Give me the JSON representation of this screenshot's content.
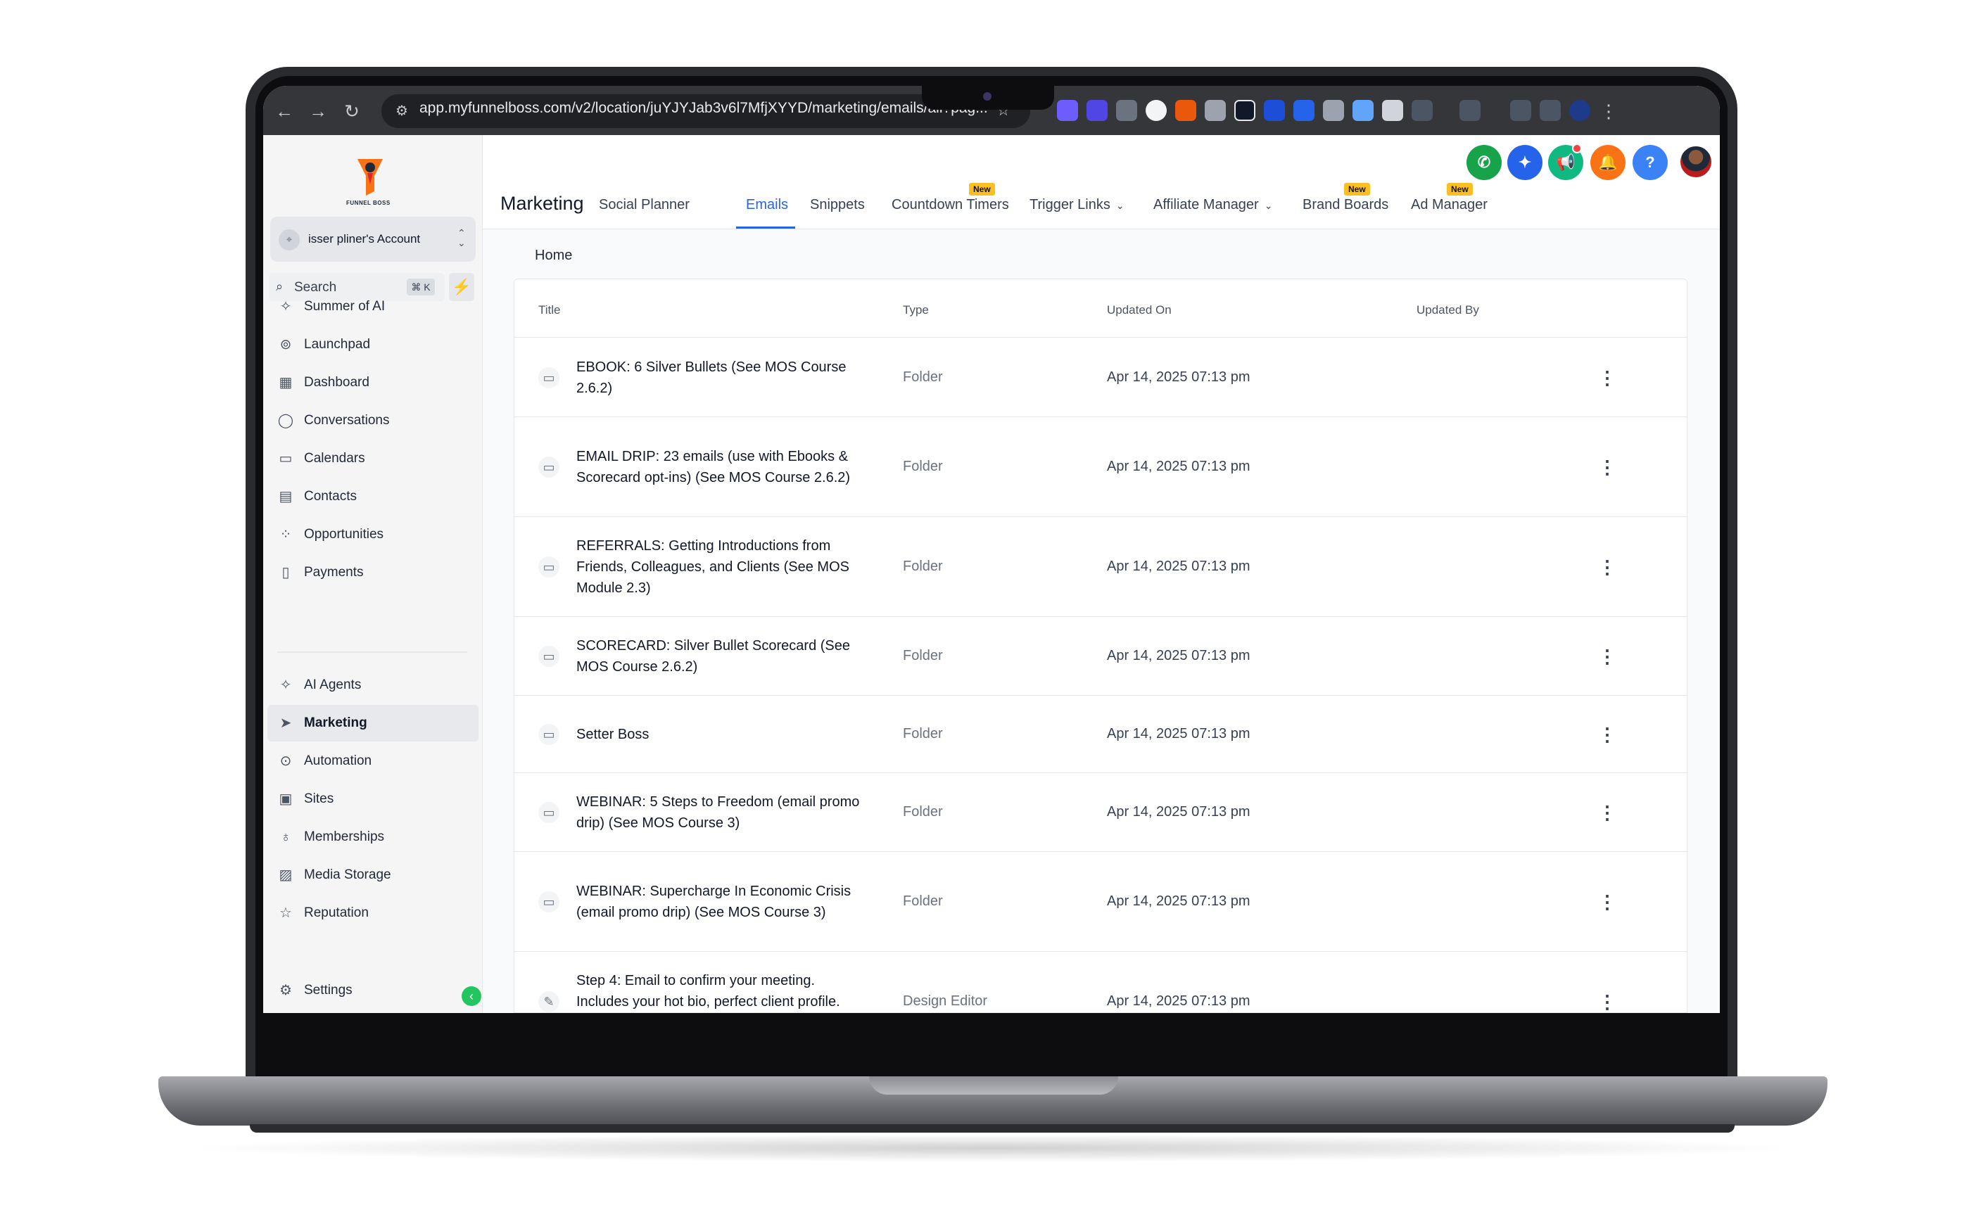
{
  "browser": {
    "url": "app.myfunnelboss.com/v2/location/juYJYJab3v6l7MfjXYYD/marketing/emails/all?pag..."
  },
  "app": {
    "logo_text": "FUNNEL BOSS"
  },
  "sidebar": {
    "account_name": "isser pliner's Account",
    "search_label": "Search",
    "search_shortcut": "⌘ K",
    "items": [
      {
        "label": "Summer of AI",
        "icon": "sparkle-icon",
        "glyph": "✧"
      },
      {
        "label": "Launchpad",
        "icon": "rocket-icon",
        "glyph": "⊚"
      },
      {
        "label": "Dashboard",
        "icon": "grid-icon",
        "glyph": "▦"
      },
      {
        "label": "Conversations",
        "icon": "chat-bubble-icon",
        "glyph": "◯"
      },
      {
        "label": "Calendars",
        "icon": "calendar-icon",
        "glyph": "▭"
      },
      {
        "label": "Contacts",
        "icon": "contacts-icon",
        "glyph": "▤"
      },
      {
        "label": "Opportunities",
        "icon": "pipeline-icon",
        "glyph": "⁘"
      },
      {
        "label": "Payments",
        "icon": "receipt-icon",
        "glyph": "▯"
      }
    ],
    "items2": [
      {
        "label": "AI Agents",
        "icon": "sparkle-icon",
        "glyph": "✧"
      },
      {
        "label": "Marketing",
        "icon": "send-icon",
        "glyph": "➤",
        "active": true
      },
      {
        "label": "Automation",
        "icon": "automation-icon",
        "glyph": "⊙"
      },
      {
        "label": "Sites",
        "icon": "globe-icon",
        "glyph": "▣"
      },
      {
        "label": "Memberships",
        "icon": "award-icon",
        "glyph": "♁"
      },
      {
        "label": "Media Storage",
        "icon": "image-icon",
        "glyph": "▨"
      },
      {
        "label": "Reputation",
        "icon": "star-icon",
        "glyph": "☆"
      }
    ],
    "settings_label": "Settings"
  },
  "header": {
    "title": "Marketing",
    "tabs": [
      {
        "label": "Social Planner"
      },
      {
        "label": "Emails",
        "active": true
      },
      {
        "label": "Snippets"
      },
      {
        "label": "Countdown Timers",
        "badge": "New"
      },
      {
        "label": "Trigger Links",
        "dropdown": true
      },
      {
        "label": "Affiliate Manager",
        "dropdown": true
      },
      {
        "label": "Brand Boards",
        "badge": "New"
      },
      {
        "label": "Ad Manager",
        "badge": "New"
      }
    ],
    "help_glyph": "?"
  },
  "content": {
    "breadcrumb": "Home",
    "columns": [
      "Title",
      "Type",
      "Updated On",
      "Updated By"
    ],
    "rows": [
      {
        "title": "EBOOK: 6 Silver Bullets (See MOS Course 2.6.2)",
        "type": "Folder",
        "updated_on": "Apr 14, 2025 07:13 pm",
        "icon": "folder-icon"
      },
      {
        "title": "EMAIL DRIP: 23 emails (use with Ebooks & Scorecard opt-ins) (See MOS Course 2.6.2)",
        "type": "Folder",
        "updated_on": "Apr 14, 2025 07:13 pm",
        "icon": "folder-icon"
      },
      {
        "title": "REFERRALS: Getting Introductions from Friends, Colleagues, and Clients (See MOS Module 2.3)",
        "type": "Folder",
        "updated_on": "Apr 14, 2025 07:13 pm",
        "icon": "folder-icon"
      },
      {
        "title": "SCORECARD: Silver Bullet Scorecard (See MOS Course 2.6.2)",
        "type": "Folder",
        "updated_on": "Apr 14, 2025 07:13 pm",
        "icon": "folder-icon"
      },
      {
        "title": "Setter Boss",
        "type": "Folder",
        "updated_on": "Apr 14, 2025 07:13 pm",
        "icon": "folder-icon"
      },
      {
        "title": "WEBINAR: 5 Steps to Freedom (email promo drip) (See MOS Course 3)",
        "type": "Folder",
        "updated_on": "Apr 14, 2025 07:13 pm",
        "icon": "folder-icon"
      },
      {
        "title": "WEBINAR: Supercharge In Economic Crisis (email promo drip) (See MOS Course 3)",
        "type": "Folder",
        "updated_on": "Apr 14, 2025 07:13 pm",
        "icon": "folder-icon"
      },
      {
        "title": "Step 4: Email to confirm your meeting. Includes your hot bio, perfect client profile.",
        "type": "Design Editor",
        "updated_on": "Apr 14, 2025 07:13 pm",
        "icon": "pencil-icon"
      }
    ]
  },
  "colors": {
    "accent": "#2563eb",
    "phone": "#16a34a",
    "sparkle": "#2563eb",
    "announce": "#10b981",
    "bell": "#f97316",
    "help": "#3b82f6",
    "badge": "#fbbf24"
  }
}
